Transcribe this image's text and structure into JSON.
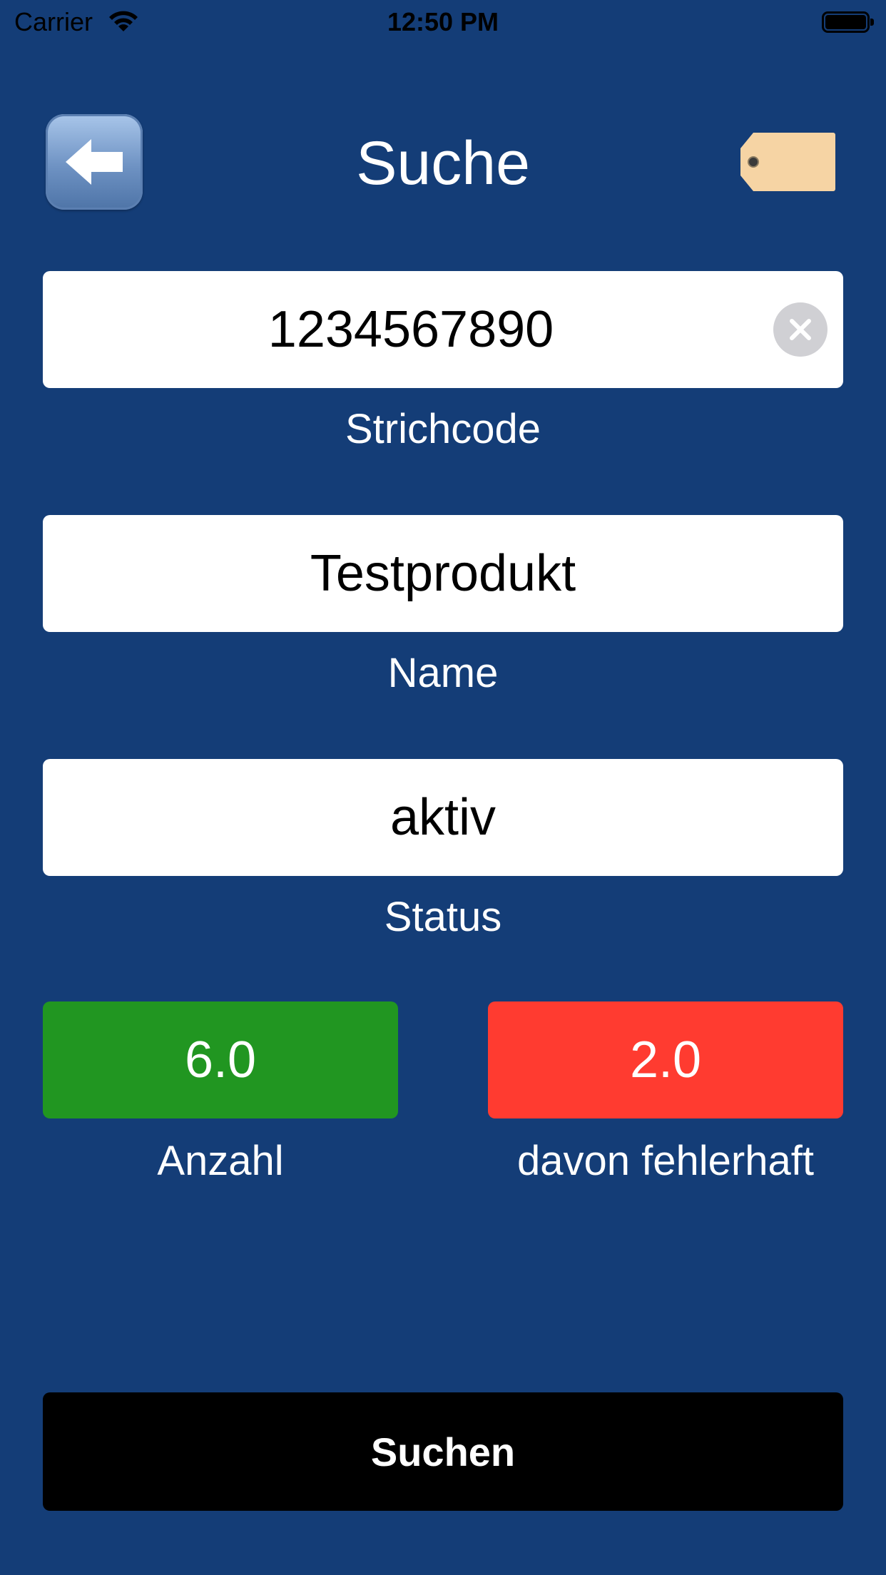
{
  "status_bar": {
    "carrier": "Carrier",
    "time": "12:50 PM"
  },
  "header": {
    "title": "Suche",
    "back_icon": "back-arrow-icon",
    "tag_icon": "price-tag-icon"
  },
  "fields": {
    "barcode": {
      "value": "1234567890",
      "label": "Strichcode"
    },
    "name": {
      "value": "Testprodukt",
      "label": "Name"
    },
    "status": {
      "value": "aktiv",
      "label": "Status"
    }
  },
  "counters": {
    "count": {
      "value": "6.0",
      "label": "Anzahl",
      "color": "#219621"
    },
    "defective": {
      "value": "2.0",
      "label": "davon fehlerhaft",
      "color": "#ff3b30"
    }
  },
  "search_button": {
    "label": "Suchen"
  },
  "colors": {
    "background": "#143d77",
    "field_background": "#ffffff",
    "button_background": "#000000"
  }
}
